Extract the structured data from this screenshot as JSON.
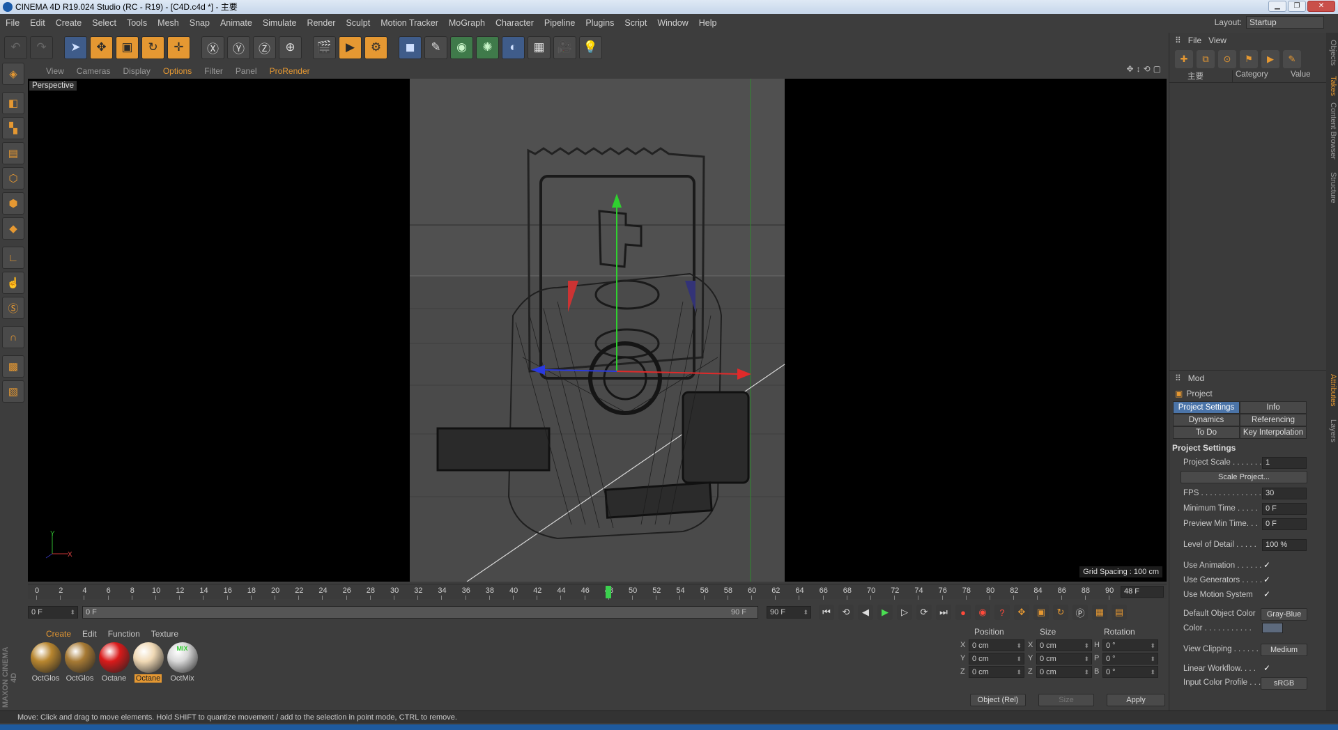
{
  "window": {
    "title": "CINEMA 4D R19.024 Studio (RC - R19) - [C4D.c4d *] - 主要"
  },
  "menu": [
    "File",
    "Edit",
    "Create",
    "Select",
    "Tools",
    "Mesh",
    "Snap",
    "Animate",
    "Simulate",
    "Render",
    "Sculpt",
    "Motion Tracker",
    "MoGraph",
    "Character",
    "Pipeline",
    "Plugins",
    "Script",
    "Window",
    "Help"
  ],
  "layout": {
    "label": "Layout:",
    "value": "Startup"
  },
  "viewport": {
    "menu": [
      "View",
      "Cameras",
      "Display",
      "Options",
      "Filter",
      "Panel",
      "ProRender"
    ],
    "active_menu": "Options",
    "camera_label": "Perspective",
    "grid_spacing": "Grid Spacing : 100 cm",
    "axis": {
      "y": "Y",
      "x": "X"
    }
  },
  "timeline": {
    "ticks": [
      "0",
      "2",
      "4",
      "6",
      "8",
      "10",
      "12",
      "14",
      "16",
      "18",
      "20",
      "22",
      "24",
      "26",
      "28",
      "30",
      "32",
      "34",
      "36",
      "38",
      "40",
      "42",
      "44",
      "46",
      "48",
      "50",
      "52",
      "54",
      "56",
      "58",
      "60",
      "62",
      "64",
      "66",
      "68",
      "70",
      "72",
      "74",
      "76",
      "78",
      "80",
      "82",
      "84",
      "86",
      "88",
      "90"
    ],
    "current_frame": 48,
    "current_display": "48 F",
    "start_field": "0 F",
    "scrub_start": "0 F",
    "scrub_end": "90 F",
    "end_field": "90 F"
  },
  "materials": {
    "menu": [
      "Create",
      "Edit",
      "Function",
      "Texture"
    ],
    "active_menu": "Create",
    "items": [
      {
        "name": "OctGlos",
        "color": "#b8862f"
      },
      {
        "name": "OctGlos",
        "color": "#a77a34"
      },
      {
        "name": "Octane",
        "color": "#d91a1a"
      },
      {
        "name": "Octane",
        "color": "#f0d9b5",
        "selected": true
      },
      {
        "name": "OctMix",
        "color": "#d8d8d8",
        "badge": "MIX"
      }
    ],
    "brand": "MAXON CINEMA 4D"
  },
  "coordinates": {
    "headers": [
      "Position",
      "Size",
      "Rotation"
    ],
    "rows": [
      {
        "axis": "X",
        "pos": "0 cm",
        "saxis": "X",
        "size": "0 cm",
        "raxis": "H",
        "rot": "0 °"
      },
      {
        "axis": "Y",
        "pos": "0 cm",
        "saxis": "Y",
        "size": "0 cm",
        "raxis": "P",
        "rot": "0 °"
      },
      {
        "axis": "Z",
        "pos": "0 cm",
        "saxis": "Z",
        "size": "0 cm",
        "raxis": "B",
        "rot": "0 °"
      }
    ],
    "mode": "Object (Rel)",
    "size_mode": "Size",
    "apply": "Apply"
  },
  "status": "Move: Click and drag to move elements. Hold SHIFT to quantize movement / add to the selection in point mode, CTRL to remove.",
  "objects_panel": {
    "menu": [
      "File",
      "View"
    ],
    "columns": {
      "name": "主要",
      "category": "Category",
      "value": "Value"
    }
  },
  "attributes": {
    "mode": "Mod",
    "object": "Project",
    "tabs": [
      "Project Settings",
      "Info",
      "Dynamics",
      "Referencing",
      "To Do",
      "Key Interpolation"
    ],
    "section": "Project Settings",
    "fields": {
      "project_scale": {
        "label": "Project Scale . . . . . . .",
        "value": "1"
      },
      "scale_project": "Scale Project...",
      "fps": {
        "label": "FPS . . . . . . . . . . . . . .",
        "value": "30"
      },
      "min_time": {
        "label": "Minimum Time . . . . .",
        "value": "0 F"
      },
      "preview_min": {
        "label": "Preview Min Time. . .",
        "value": "0 F"
      },
      "lod": {
        "label": "Level of Detail . . . . .",
        "value": "100 %"
      },
      "use_animation": {
        "label": "Use Animation . . . . . .",
        "value": "✓"
      },
      "use_generators": {
        "label": "Use Generators . . . . .",
        "value": "✓"
      },
      "use_motion": {
        "label": "Use Motion System",
        "value": "✓"
      },
      "default_color": {
        "label": "Default Object Color",
        "value": "Gray-Blue"
      },
      "color": {
        "label": "Color . . . . . . . . . . ."
      },
      "view_clipping": {
        "label": "View Clipping . . . . . .",
        "value": "Medium"
      },
      "linear_workflow": {
        "label": "Linear Workflow. . . .",
        "value": "✓"
      },
      "input_profile": {
        "label": "Input Color Profile . . .",
        "value": "sRGB"
      }
    }
  },
  "side_tabs": [
    "Objects",
    "Takes",
    "Content Browser",
    "Structure",
    "Attributes",
    "Layers"
  ]
}
